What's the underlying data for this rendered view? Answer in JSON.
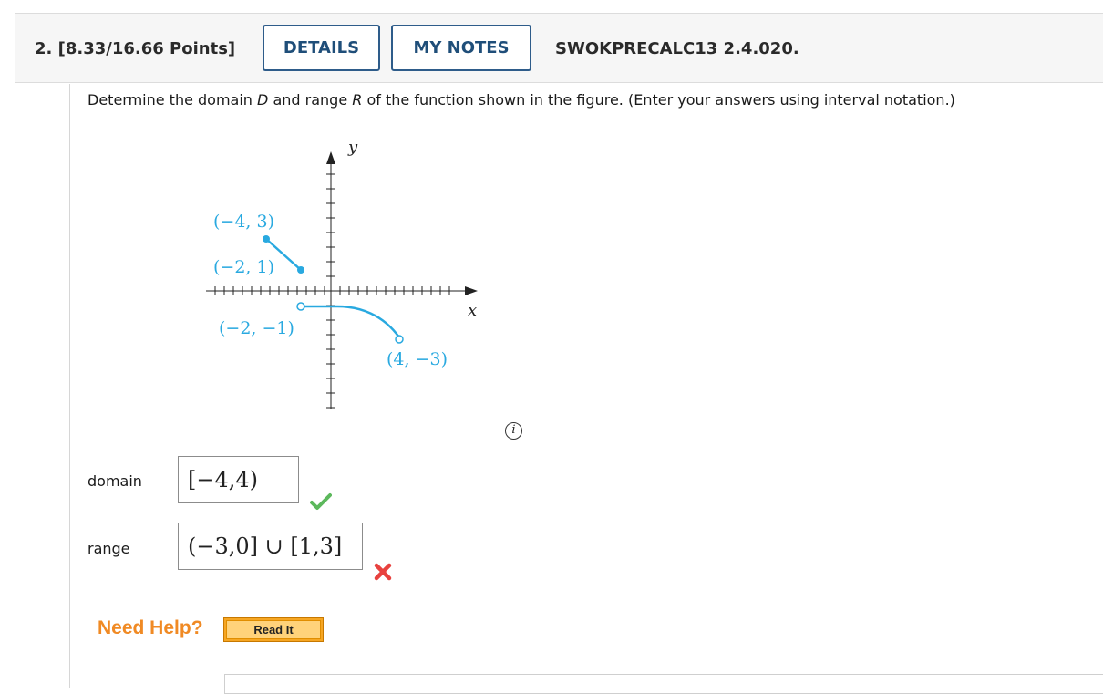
{
  "question": {
    "number_points": "2. [8.33/16.66 Points]",
    "details_label": "DETAILS",
    "notes_label": "MY NOTES",
    "code": "SWOKPRECALC13 2.4.020.",
    "prompt_a": "Determine the domain ",
    "prompt_D": "D",
    "prompt_b": " and range ",
    "prompt_R": "R",
    "prompt_c": " of the function shown in the figure. (Enter your answers using interval notation.)"
  },
  "graph": {
    "y_label": "y",
    "x_label": "x",
    "point_a": "(−4, 3)",
    "point_b": "(−2, 1)",
    "point_c": "(−2, −1)",
    "point_d": "(4, −3)",
    "curve_color": "#29a9e0"
  },
  "info_glyph": "i",
  "answers": {
    "domain_label": "domain",
    "domain_value": "[−4,4)",
    "domain_status": "correct",
    "range_label": "range",
    "range_value": "(−3,0] ∪ [1,3]",
    "range_status": "incorrect"
  },
  "help": {
    "need_help": "Need Help?",
    "read_it": "Read It"
  }
}
